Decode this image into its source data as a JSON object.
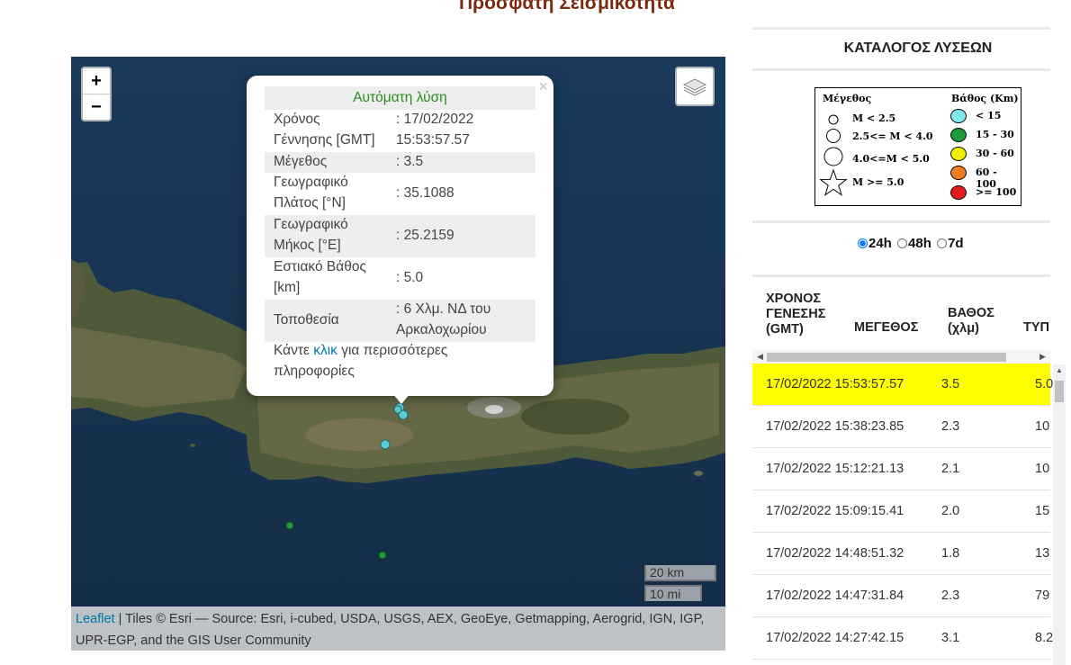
{
  "page_title": "Πρόσφατη Σεισμικότητα",
  "map": {
    "zoom_in": "+",
    "zoom_out": "−",
    "scale_km": "20 km",
    "scale_mi": "10 mi",
    "attribution_link": "Leaflet",
    "attribution_text": " | Tiles © Esri — Source: Esri, i-cubed, USDA, USGS, AEX, GeoEye, Getmapping, Aerogrid, IGN, IGP, UPR-EGP, and the GIS User Community",
    "popup": {
      "close": "×",
      "header": "Αυτόματη λύση",
      "rows": [
        {
          "k1": "Χρόνος",
          "k2": "Γέννησης [GMT]",
          "v1": ": 17/02/2022",
          "v2": "15:53:57.57"
        },
        {
          "k1": "Μέγεθος",
          "k2": "",
          "v1": ": 3.5",
          "v2": ""
        },
        {
          "k1": "Γεωγραφικό",
          "k2": "Πλάτος [°N]",
          "v1": ": 35.1088",
          "v2": ""
        },
        {
          "k1": "Γεωγραφικό",
          "k2": "Μήκος [°E]",
          "v1": ": 25.2159",
          "v2": ""
        },
        {
          "k1": "Εστιακό Βάθος",
          "k2": "[km]",
          "v1": ": 5.0",
          "v2": ""
        },
        {
          "k1": "Τοποθεσία",
          "k2": "",
          "v1": ": 6 Χλμ. ΝΔ του",
          "v2": "Αρκαλοχωρίου"
        }
      ],
      "more_pre": "Κάντε ",
      "more_link": "κλικ",
      "more_post": " για περισσότερες πληροφορίες"
    }
  },
  "panel": {
    "title": "ΚΑΤΑΛΟΓΟΣ ΛΥΣΕΩΝ",
    "legend": {
      "magnitude_title": "Μέγεθος",
      "depth_title": "Βάθος (Km)",
      "magnitudes": [
        "M < 2.5",
        "2.5<= M < 4.0",
        "4.0<=M < 5.0",
        "M >= 5.0"
      ],
      "depths": [
        {
          "label": "< 15",
          "color": "#7fe8ef"
        },
        {
          "label": "15 - 30",
          "color": "#1f9a3c"
        },
        {
          "label": "30 - 60",
          "color": "#f2ee00"
        },
        {
          "label": "60 - 100",
          "color": "#f37b1f"
        },
        {
          "label": ">= 100",
          "color": "#e41b1b"
        }
      ]
    },
    "periods": [
      "24h",
      "48h",
      "7d"
    ],
    "selected_period": "24h",
    "columns": [
      "ΧΡΟΝΟΣ ΓΕΝΕΣΗΣ (GMT)",
      "ΜΕΓΕΘΟΣ",
      "ΒΑΘΟΣ (χλμ)",
      "ΤΥΠ"
    ],
    "rows": [
      {
        "time": "17/02/2022 15:53:57.57",
        "mag": "3.5",
        "depth": "5.0"
      },
      {
        "time": "17/02/2022 15:38:23.85",
        "mag": "2.3",
        "depth": "10"
      },
      {
        "time": "17/02/2022 15:12:21.13",
        "mag": "2.1",
        "depth": "10"
      },
      {
        "time": "17/02/2022 15:09:15.41",
        "mag": "2.0",
        "depth": "15"
      },
      {
        "time": "17/02/2022 14:48:51.32",
        "mag": "1.8",
        "depth": "13"
      },
      {
        "time": "17/02/2022 14:47:31.84",
        "mag": "2.3",
        "depth": "79"
      },
      {
        "time": "17/02/2022 14:27:42.15",
        "mag": "3.1",
        "depth": "8.2"
      }
    ],
    "highlight_color": "#ffff00"
  }
}
